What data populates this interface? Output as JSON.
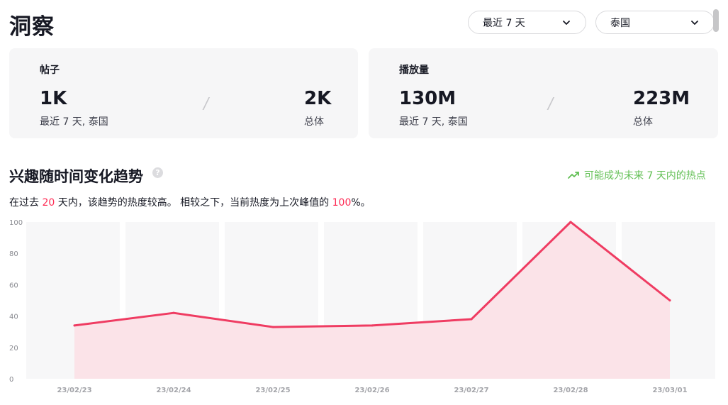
{
  "header": {
    "title": "洞察",
    "range_dropdown": "最近 7 天",
    "region_dropdown": "泰国"
  },
  "cards": {
    "posts": {
      "title": "帖子",
      "recent_value": "1K",
      "recent_label": "最近 7 天, 泰国",
      "total_value": "2K",
      "total_label": "总体"
    },
    "views": {
      "title": "播放量",
      "recent_value": "130M",
      "recent_label": "最近 7 天, 泰国",
      "total_value": "223M",
      "total_label": "总体"
    }
  },
  "trend": {
    "title": "兴趣随时间变化趋势",
    "help": "?",
    "hot_label": "可能成为未来 7 天内的热点",
    "desc_prefix": "在过去 ",
    "desc_days": "20",
    "desc_middle": " 天内，该趋势的热度较高。 相较之下，当前热度为上次峰值的 ",
    "desc_peak": "100",
    "desc_suffix": "%。"
  },
  "colors": {
    "accent": "#fe2c55",
    "line": "#ef3c62",
    "area": "#fbe3e8",
    "hot": "#61bf53"
  },
  "chart_data": {
    "type": "area",
    "categories": [
      "23/02/23",
      "23/02/24",
      "23/02/25",
      "23/02/26",
      "23/02/27",
      "23/02/28",
      "23/03/01"
    ],
    "values": [
      34,
      42,
      33,
      34,
      38,
      100,
      50
    ],
    "yticks": [
      0,
      20,
      40,
      60,
      80,
      100
    ],
    "ylim": [
      0,
      100
    ],
    "grid": false
  }
}
